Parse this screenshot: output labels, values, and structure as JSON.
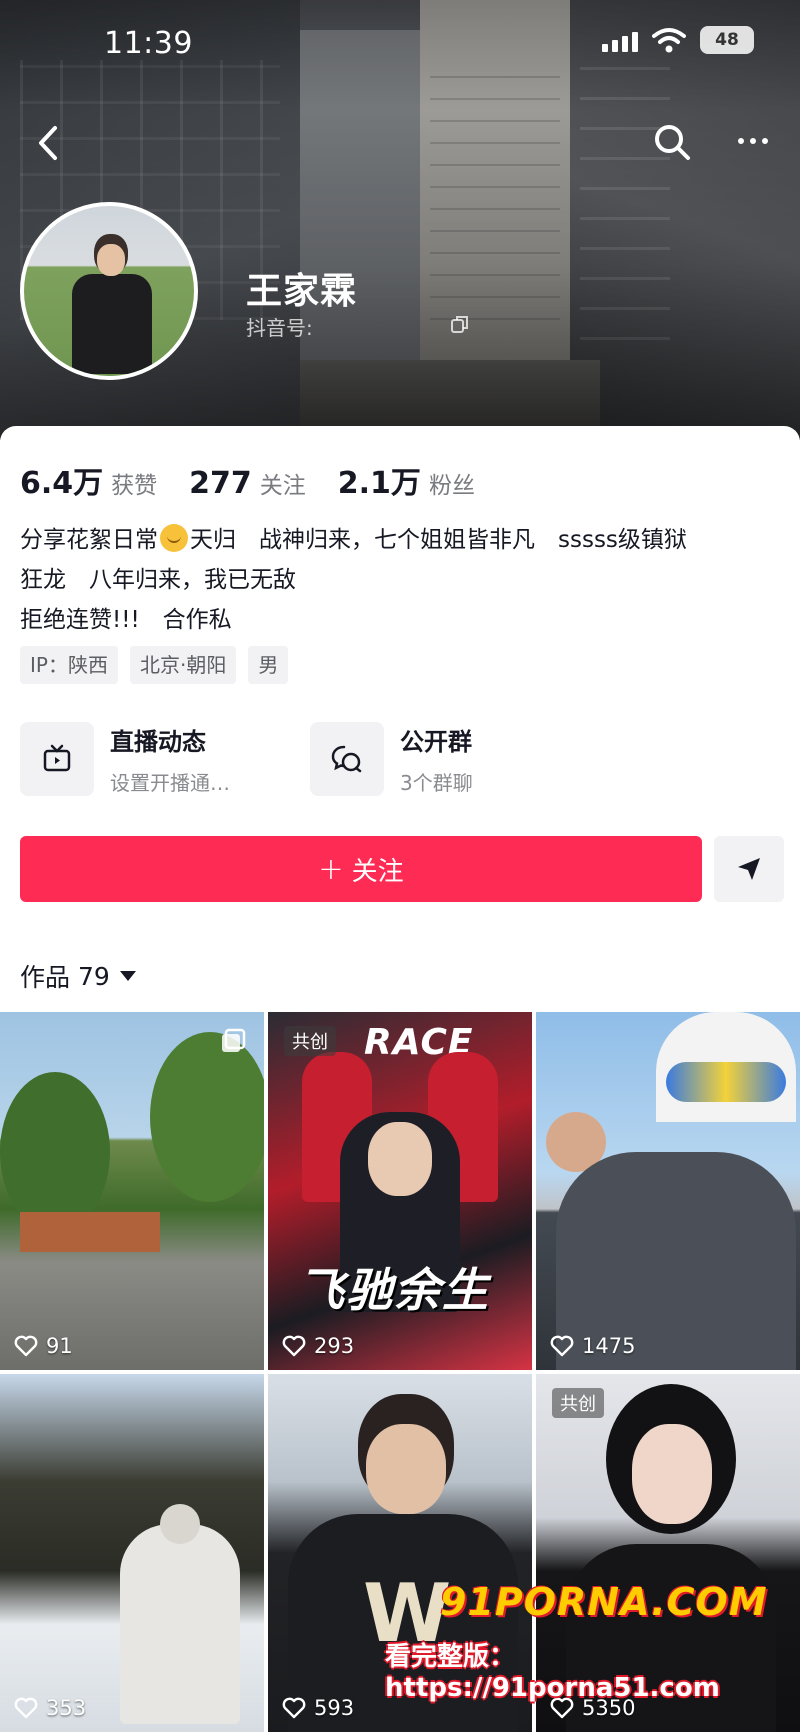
{
  "status_bar": {
    "time": "11:39",
    "battery": "48"
  },
  "profile": {
    "name": "王家霖",
    "id_label": "抖音号:"
  },
  "stats": [
    {
      "value": "6.4万",
      "label": "获赞"
    },
    {
      "value": "277",
      "label": "关注"
    },
    {
      "value": "2.1万",
      "label": "粉丝"
    }
  ],
  "bio": {
    "line1_a": "分享花絮日常",
    "line1_b": "天归　战神归来，七个姐姐皆非凡　sssss级镇狱",
    "line2": "狂龙　八年归来，我已无敌",
    "line3": "拒绝连赞!!!　合作私"
  },
  "tags": [
    "IP：陕西",
    "北京·朝阳",
    "男"
  ],
  "cards": [
    {
      "title": "直播动态",
      "subtitle": "设置开播通…"
    },
    {
      "title": "公开群",
      "subtitle": "3个群聊"
    }
  ],
  "follow": {
    "plus": "+",
    "label": "关注"
  },
  "works": {
    "label": "作品",
    "count": "79"
  },
  "videos": [
    {
      "likes": "91",
      "badge": ""
    },
    {
      "likes": "293",
      "badge": "共创",
      "overlay_title": "飞驰余生",
      "overlay_top": "RACE"
    },
    {
      "likes": "1475",
      "badge": ""
    },
    {
      "likes": "353",
      "badge": ""
    },
    {
      "likes": "593",
      "badge": ""
    },
    {
      "likes": "5350",
      "badge": "共创"
    }
  ],
  "watermark": {
    "brand": "91PORNA.COM",
    "url_line": "看完整版：https://91porna51.com"
  },
  "colors": {
    "accent": "#fe2c55",
    "text": "#161823",
    "muted": "#7a7b80",
    "chip_bg": "#f2f2f4"
  }
}
